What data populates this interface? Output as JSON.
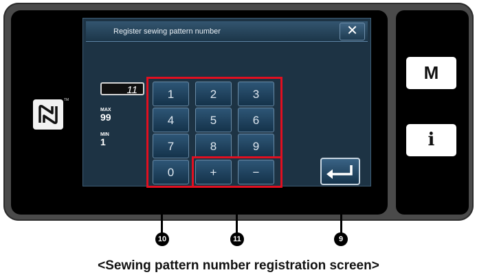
{
  "dialog": {
    "title": "Register sewing pattern number",
    "close_symbol": "✕"
  },
  "value": "11",
  "limits": {
    "max_label": "MAX",
    "max_value": "99",
    "min_label": "MIN",
    "min_value": "1"
  },
  "keypad": {
    "keys": [
      "1",
      "2",
      "3",
      "4",
      "5",
      "6",
      "7",
      "8",
      "9",
      "0",
      "+",
      "−"
    ]
  },
  "enter_icon": "enter-arrow-icon",
  "side_buttons": {
    "mode_label": "M",
    "info_label": "i"
  },
  "callouts": {
    "keypad_marker": "10",
    "plusminus_marker": "11",
    "enter_marker": "9"
  },
  "caption": "<Sewing pattern number registration screen>"
}
